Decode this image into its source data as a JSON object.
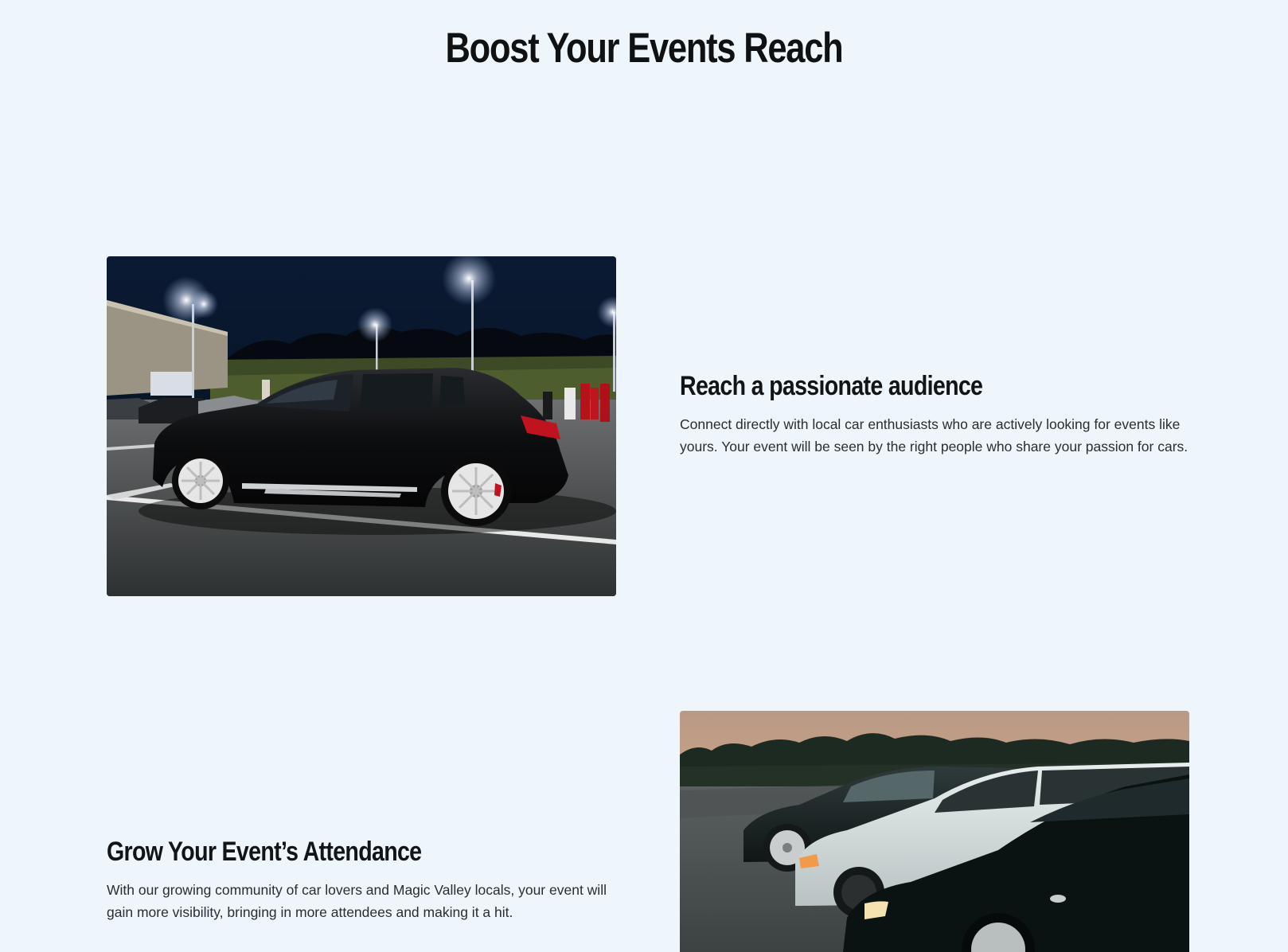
{
  "section": {
    "title": "Boost Your Events Reach"
  },
  "features": [
    {
      "heading": "Reach a passionate audience",
      "text": "Connect directly with local car enthusiasts who are actively looking for events like yours. Your event will be seen by the right people who share your passion for cars."
    },
    {
      "heading": "Grow Your Event’s Attendance",
      "text": "With our growing community of car lovers and Magic Valley locals, your event will gain more visibility, bringing in more attendees and making it a hit."
    }
  ],
  "colors": {
    "background": "#eef5fb",
    "heading": "#121416",
    "body_text": "#2a2d31"
  }
}
